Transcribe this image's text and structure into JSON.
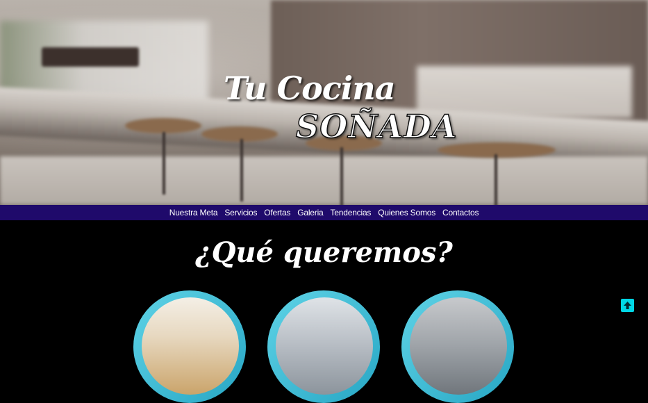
{
  "hero": {
    "title_line1": "Tu Cocina",
    "title_line2": "SOÑADA"
  },
  "nav": {
    "items": [
      "Nuestra Meta",
      "Servicios",
      "Ofertas",
      "Galeria",
      "Tendencias",
      "Quienes Somos",
      "Contactos"
    ]
  },
  "section": {
    "heading": "¿Qué queremos?"
  },
  "colors": {
    "nav_bg": "#1f0a6b",
    "accent": "#00d7e6",
    "circle_ring": "#27a6c4",
    "page_bg": "#000000"
  },
  "icons": {
    "scroll_top": "arrow-up-icon"
  }
}
